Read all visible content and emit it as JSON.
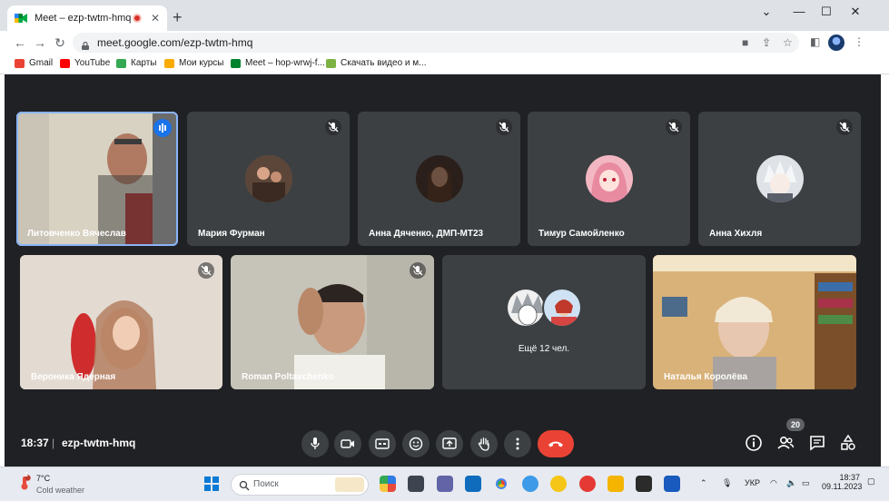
{
  "browser": {
    "tab_title": "Meet – ezp-twtm-hmq",
    "url": "meet.google.com/ezp-twtm-hmq",
    "bookmarks": [
      {
        "label": "Gmail",
        "color": "#ea4335"
      },
      {
        "label": "YouTube",
        "color": "#ff0000"
      },
      {
        "label": "Карты",
        "color": "#34a853"
      },
      {
        "label": "Мои курсы",
        "color": "#f9ab00"
      },
      {
        "label": "Meet – hop-wrwj-f...",
        "color": "#00832d"
      },
      {
        "label": "Скачать видео и м...",
        "color": "#7cb342"
      }
    ]
  },
  "meet": {
    "participants": [
      {
        "name": "Литовченко Вячеслав",
        "state": "speaking",
        "video": true
      },
      {
        "name": "Мария Фурман",
        "state": "muted",
        "video": false
      },
      {
        "name": "Анна Дяченко, ДМП-МТ23",
        "state": "muted",
        "video": false
      },
      {
        "name": "Тимур Самойленко",
        "state": "muted",
        "video": false
      },
      {
        "name": "Анна Хихля",
        "state": "muted",
        "video": false
      },
      {
        "name": "Вероника Ядерная",
        "state": "muted",
        "video": true
      },
      {
        "name": "Roman Poltavchenko",
        "state": "muted",
        "video": true
      },
      {
        "name": "Наталья Королёва",
        "state": "unmuted",
        "video": true
      }
    ],
    "more_participants": "Ещё 12 чел.",
    "time": "18:37",
    "separator": "|",
    "meeting_code": "ezp-twtm-hmq",
    "participant_count": "20",
    "controls": [
      "mic-button",
      "camera-button",
      "captions-button",
      "emoji-button",
      "present-button",
      "raise-hand-button",
      "more-options-button",
      "leave-call-button"
    ],
    "accent_color": "#8ab4f8",
    "end_call_color": "#ea4335"
  },
  "taskbar": {
    "weather_temp": "7°C",
    "weather_desc": "Cold weather",
    "weather_badge": "1",
    "search_placeholder": "Поиск",
    "language": "УКР",
    "time": "18:37",
    "date": "09.11.2023"
  }
}
